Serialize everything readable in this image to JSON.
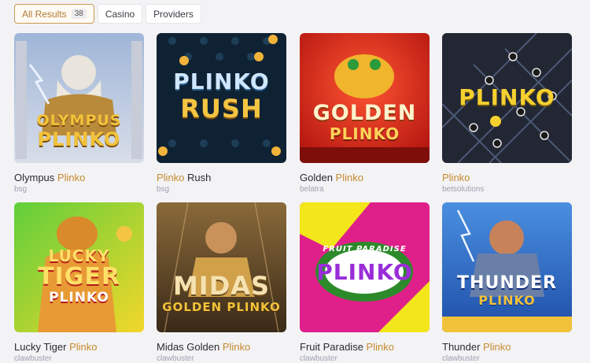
{
  "filters": [
    {
      "label": "All Results",
      "count": "38"
    },
    {
      "label": "Casino"
    },
    {
      "label": "Providers"
    }
  ],
  "games": [
    {
      "name": "Olympus",
      "highlight": "Plinko",
      "provider": "bsg",
      "art": [
        "OLYMPUS",
        "PLINKO"
      ]
    },
    {
      "name": "",
      "highlight": "Plinko",
      "suffix": " Rush",
      "provider": "bsg",
      "art": [
        "PLINKO",
        "RUSH"
      ]
    },
    {
      "name": "Golden",
      "highlight": "Plinko",
      "provider": "belatra",
      "art": [
        "GOLDEN",
        "PLINKO"
      ]
    },
    {
      "name": "",
      "highlight": "Plinko",
      "provider": "betsolutions",
      "art": [
        "PLINKO"
      ]
    },
    {
      "name": "Lucky Tiger",
      "highlight": "Plinko",
      "provider": "clawbuster",
      "art": [
        "LUCKY",
        "TIGER",
        "PLINKO"
      ]
    },
    {
      "name": "Midas Golden",
      "highlight": "Plinko",
      "provider": "clawbuster",
      "art": [
        "MIDAS",
        "GOLDEN PLINKO"
      ]
    },
    {
      "name": "Fruit Paradise",
      "highlight": "Plinko",
      "provider": "clawbuster",
      "art": [
        "FRUIT PARADISE",
        "PLINKO"
      ]
    },
    {
      "name": "Thunder",
      "highlight": "Plinko",
      "provider": "clawbuster",
      "art": [
        "THUNDER",
        "PLINKO"
      ]
    }
  ]
}
